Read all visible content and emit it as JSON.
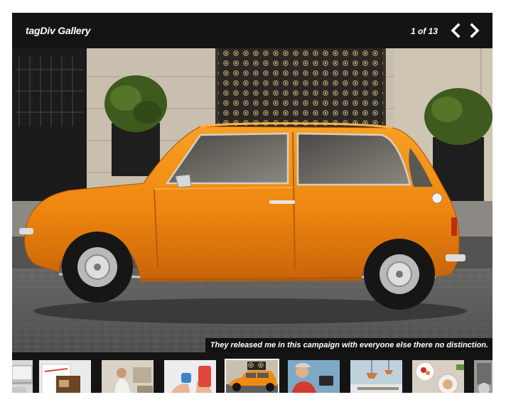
{
  "gallery": {
    "title": "tagDiv Gallery",
    "counter": "1 of 13",
    "prev_icon": "chevron-left-icon",
    "next_icon": "chevron-right-icon",
    "caption": "They released me in this campaign with everyone else there no distinction."
  },
  "colors": {
    "header_bg": "#141414",
    "car_orange": "#f08a10",
    "text": "#ffffff"
  },
  "thumbnails": [
    {
      "subject": "laptop-partial",
      "active": false
    },
    {
      "subject": "notebook-and-pen",
      "active": false
    },
    {
      "subject": "woman-in-living-room",
      "active": false
    },
    {
      "subject": "hands-with-phone",
      "active": false
    },
    {
      "subject": "orange-car",
      "active": true
    },
    {
      "subject": "woman-with-camera",
      "active": false
    },
    {
      "subject": "interior-lamps",
      "active": false
    },
    {
      "subject": "food-table",
      "active": false
    },
    {
      "subject": "partial-image",
      "active": false
    }
  ]
}
